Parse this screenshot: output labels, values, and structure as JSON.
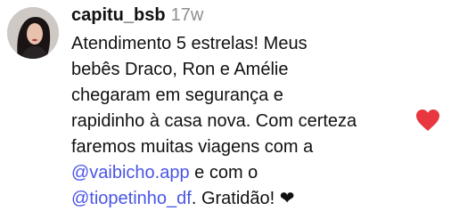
{
  "comment": {
    "username": "capitu_bsb",
    "timestamp": "17w",
    "lines": {
      "l1": "Atendimento 5 estrelas! Meus",
      "l2": "bebês Draco, Ron e Amélie",
      "l3": "chegaram em segurança e",
      "l4": "rapidinho à casa nova. Com certeza",
      "l5": "faremos muitas viagens com a",
      "l6_mention": "@vaibicho.app",
      "l6_rest": " e com o",
      "l7_mention": "@tiopetinho_df",
      "l7_rest": ". Gratidão! ❤"
    },
    "like_icon": "heart-icon",
    "colors": {
      "mention": "#4a55e6",
      "like": "#e8373f",
      "timestamp": "#8e8e8e"
    }
  }
}
